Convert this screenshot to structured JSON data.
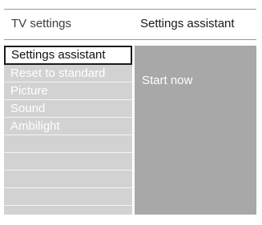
{
  "header": {
    "left_title": "TV settings",
    "right_title": "Settings assistant"
  },
  "menu": {
    "items": [
      {
        "label": "Settings assistant",
        "selected": true
      },
      {
        "label": "Reset to standard"
      },
      {
        "label": "Picture"
      },
      {
        "label": "Sound"
      },
      {
        "label": "Ambilight"
      },
      {
        "label": ""
      },
      {
        "label": ""
      },
      {
        "label": ""
      },
      {
        "label": ""
      }
    ]
  },
  "right_panel": {
    "text": "Start now"
  }
}
